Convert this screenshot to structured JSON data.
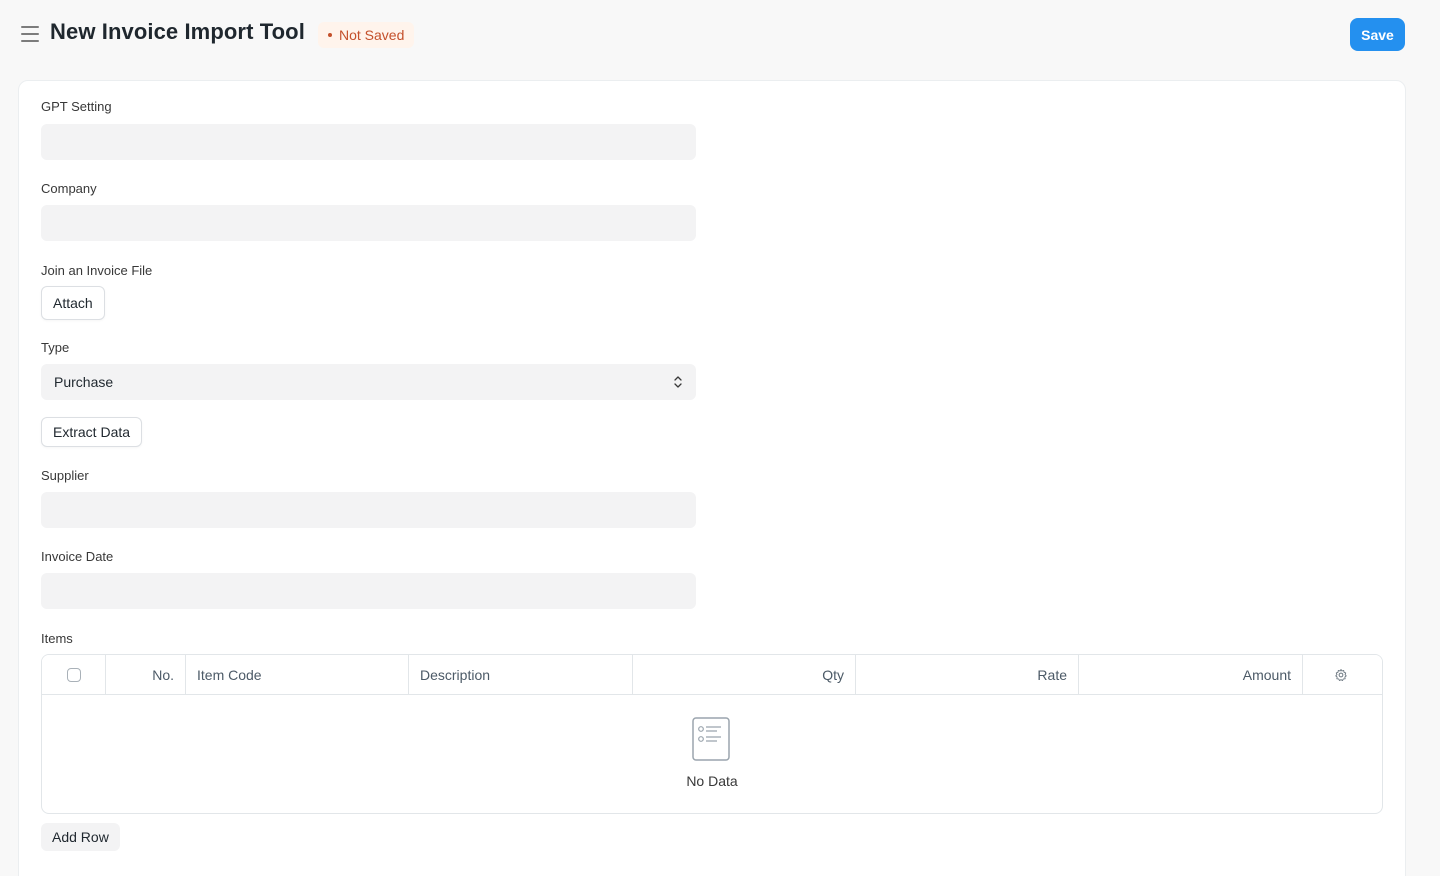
{
  "header": {
    "title": "New Invoice Import Tool",
    "status": "Not Saved",
    "save_label": "Save"
  },
  "form": {
    "gpt_setting": {
      "label": "GPT Setting",
      "value": ""
    },
    "company": {
      "label": "Company",
      "value": ""
    },
    "invoice_file": {
      "label": "Join an Invoice File",
      "button": "Attach"
    },
    "type": {
      "label": "Type",
      "value": "Purchase"
    },
    "extract_button": "Extract Data",
    "supplier": {
      "label": "Supplier",
      "value": ""
    },
    "invoice_date": {
      "label": "Invoice Date",
      "value": ""
    },
    "items": {
      "label": "Items",
      "columns": [
        "No.",
        "Item Code",
        "Description",
        "Qty",
        "Rate",
        "Amount"
      ],
      "empty_text": "No Data",
      "add_row": "Add Row"
    }
  },
  "colors": {
    "primary": "#2490ef",
    "status_bg": "#fff4ec",
    "status_text": "#c4502b",
    "control_bg": "#f3f3f4"
  },
  "icons": {
    "menu": "hamburger-icon",
    "select": "chevron-up-down-icon",
    "settings": "gear-icon",
    "empty": "list-document-icon"
  }
}
